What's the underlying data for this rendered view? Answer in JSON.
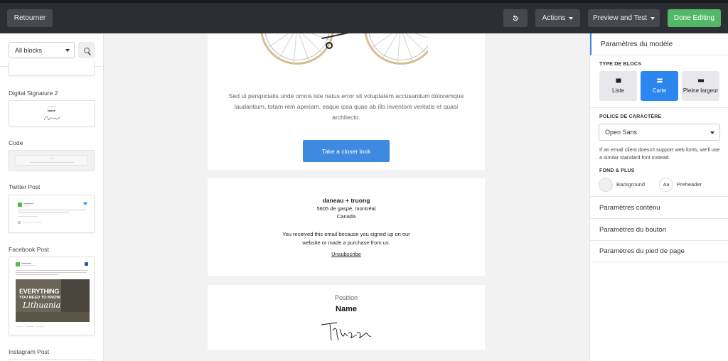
{
  "topbar": {
    "back_label": "Retourner",
    "actions_label": "Actions",
    "preview_label": "Preview and Test",
    "done_label": "Done Editing",
    "accent": "#52b866"
  },
  "left_panel": {
    "filter_value": "All blocks",
    "blocks": [
      {
        "label": "Digital Signature 2"
      },
      {
        "label": "Code"
      },
      {
        "label": "Twitter Post"
      },
      {
        "label": "Facebook Post"
      },
      {
        "label": "Instagram Post"
      }
    ],
    "signature_thumb": {
      "position": "Position",
      "name": "Name"
    },
    "facebook_thumb": {
      "banner_line1": "EVERYTHING",
      "banner_line2": "YOU NEED TO KNOW",
      "banner_line3": "Lithuania"
    }
  },
  "email": {
    "body_text": "Sed ut perspiciatis unde omnis iste natus error sit voluptatem accusantium doloremque laudantium, totam rem aperiam, eaque ipsa quae ab illo inventore veritatis et quasi architecto.",
    "cta_label": "Take a closer look",
    "footer": {
      "company": "daneau + truong",
      "address_line1": "5605 de gaspé, montréal",
      "address_line2": "Canada",
      "notice_line1": "You received this email because you signed up on our",
      "notice_line2": "website or made a purchase from us.",
      "unsubscribe": "Unsubscribe"
    },
    "signature": {
      "position": "Position",
      "name": "Name"
    },
    "accent": "#3d8ae0"
  },
  "right_panel": {
    "title": "Paramètres du modèle",
    "block_type_label": "TYPE DE BLOCS",
    "block_types": [
      {
        "label": "Liste",
        "icon": "list-icon",
        "active": false
      },
      {
        "label": "Carte",
        "icon": "card-icon",
        "active": true
      },
      {
        "label": "Pleine largeur",
        "icon": "full-width-icon",
        "active": false
      }
    ],
    "font_label": "POLICE DE CARACTÈRE",
    "font_value": "Open Sans",
    "font_help": "If an email client doesn't support web fonts, we'll use a similar standard font instead.",
    "background_label": "FOND & PLUS",
    "background_swatch": "Background",
    "preheader_swatch": "Preheader",
    "preheader_glyph": "Aa",
    "sections": [
      "Paramètres contenu",
      "Paramètres du bouton",
      "Paramètres du pied de page"
    ],
    "accent": "#2b86f0"
  }
}
